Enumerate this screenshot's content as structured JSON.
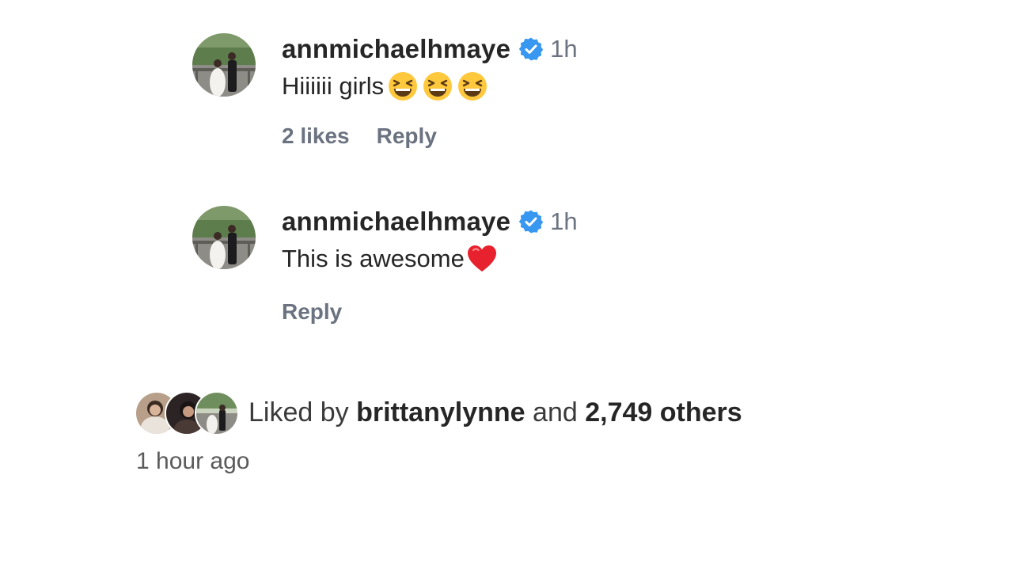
{
  "comments": [
    {
      "username": "annmichaelhmaye",
      "verified": true,
      "time": "1h",
      "text": "Hiiiiii girls",
      "emojis": [
        "grinning-squinting-face",
        "grinning-squinting-face",
        "grinning-squinting-face"
      ],
      "likes": "2 likes",
      "reply_label": "Reply"
    },
    {
      "username": "annmichaelhmaye",
      "verified": true,
      "time": "1h",
      "text": "This is awesome",
      "emojis": [
        "red-heart"
      ],
      "reply_label": "Reply"
    }
  ],
  "liked_by": {
    "prefix": "Liked by",
    "user": "brittanylynne",
    "conjunction": "and",
    "others": "2,749 others"
  },
  "timestamp": "1 hour ago",
  "colors": {
    "verified_blue": "#3897f0",
    "secondary_text": "#6b7280",
    "primary_text": "#262626"
  }
}
